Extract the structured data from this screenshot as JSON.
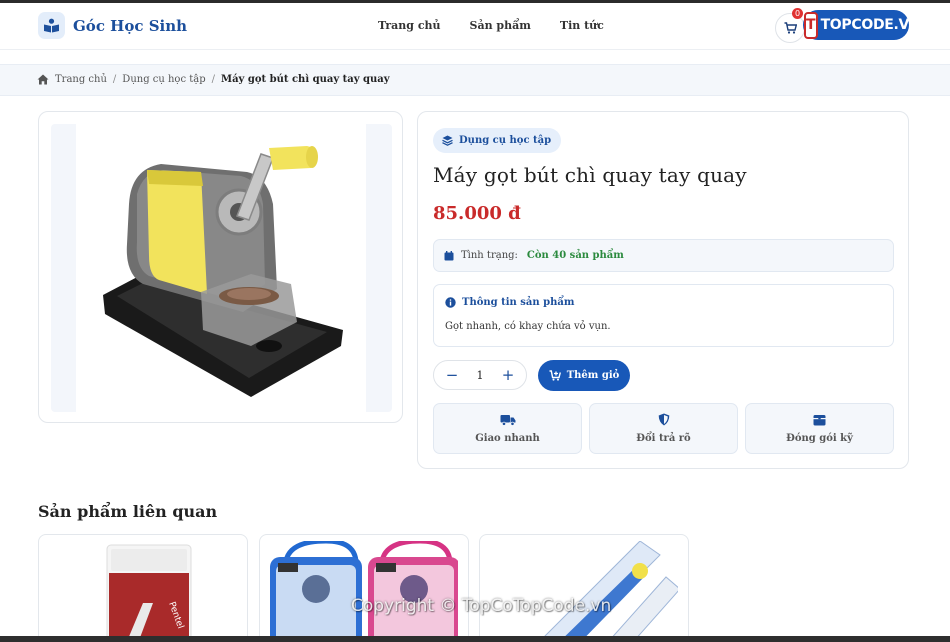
{
  "brand": {
    "name": "Góc Học Sinh",
    "color": "#1c4f9c"
  },
  "nav": {
    "items": [
      {
        "label": "Trang chủ"
      },
      {
        "label": "Sản phẩm"
      },
      {
        "label": "Tin tức"
      }
    ]
  },
  "cart": {
    "count": "0"
  },
  "watermark_logo": {
    "mark": "T",
    "text": "TOPCODE.VN"
  },
  "breadcrumb": {
    "home": "Trang chủ",
    "category": "Dụng cụ học tập",
    "current": "Máy gọt bút chì quay tay quay"
  },
  "product": {
    "category": "Dụng cụ học tập",
    "title": "Máy gọt bút chì quay tay quay",
    "price": "85.000 đ",
    "stock_label": "Tình trạng:",
    "stock_value": "Còn 40 sản phẩm",
    "info_heading": "Thông tin sản phẩm",
    "description": "Gọt nhanh, có khay chứa vỏ vụn.",
    "quantity": "1",
    "add_to_cart": "Thêm giỏ",
    "features": [
      {
        "icon": "truck-icon",
        "label": "Giao nhanh"
      },
      {
        "icon": "shield-icon",
        "label": "Đổi trả rõ"
      },
      {
        "icon": "box-icon",
        "label": "Đóng gói kỹ"
      }
    ]
  },
  "related": {
    "title": "Sản phẩm liên quan"
  },
  "copyright": "Copyright © TopCoTopCode.vn",
  "colors": {
    "primary": "#1858b8",
    "price": "#c92a2a",
    "stock": "#2b8a3e",
    "panel": "#f4f7fb"
  }
}
